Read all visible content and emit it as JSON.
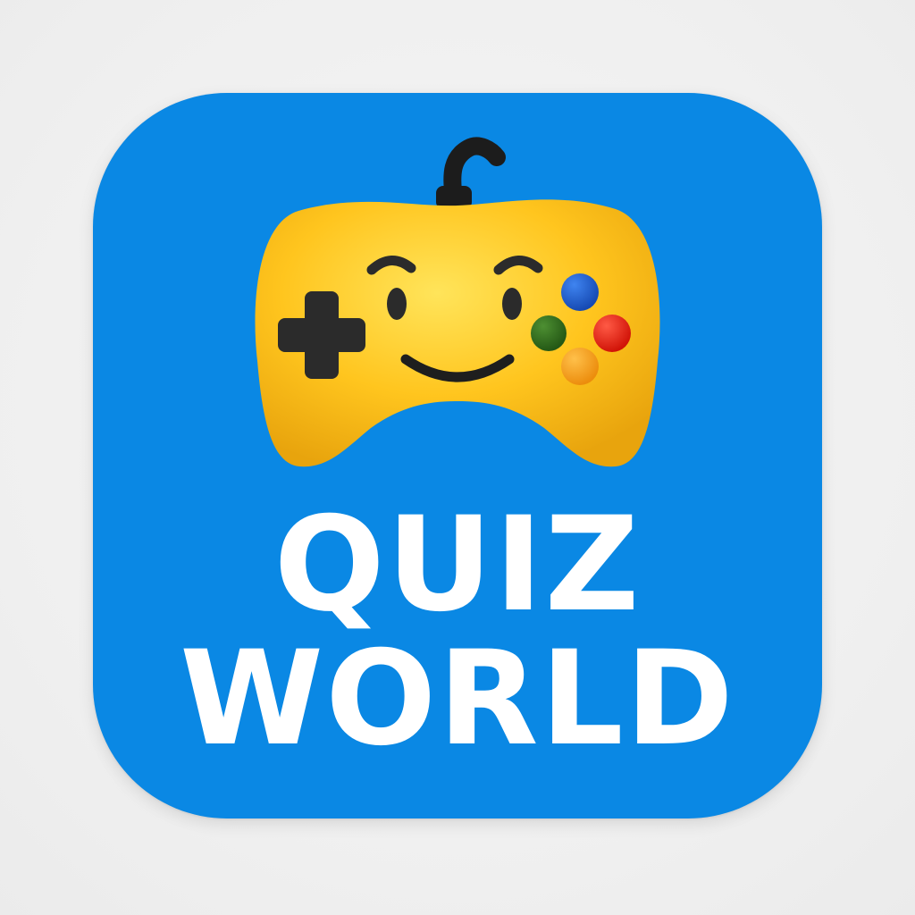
{
  "app_icon": {
    "title_lines": [
      "QUIZ",
      "WORLD"
    ],
    "mascot_icon": "smiling-game-controller-icon",
    "colors": {
      "background": "#0a88e4",
      "controller": "#ffc51e",
      "title_text": "#ffffff",
      "dpad": "#2b2b2b",
      "button_blue": "#1d5cc8",
      "button_red": "#ee1d12",
      "button_green": "#2f6d1f",
      "button_orange": "#f7a21a"
    }
  }
}
